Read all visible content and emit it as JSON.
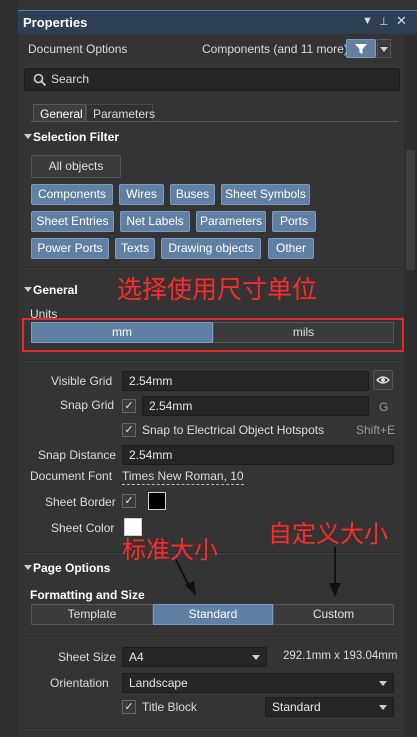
{
  "window": {
    "title": "Properties"
  },
  "header": {
    "left_label": "Document Options",
    "right_label": "Components (and 11 more)"
  },
  "search": {
    "placeholder": "Search"
  },
  "tabs": [
    {
      "label": "General"
    },
    {
      "label": "Parameters"
    }
  ],
  "selection_filter": {
    "title": "Selection Filter",
    "all_objects": "All objects",
    "chips": [
      "Components",
      "Wires",
      "Buses",
      "Sheet Symbols",
      "Sheet Entries",
      "Net Labels",
      "Parameters",
      "Ports",
      "Power Ports",
      "Texts",
      "Drawing objects",
      "Other"
    ]
  },
  "general": {
    "title": "General",
    "units_label": "Units",
    "units_options": [
      "mm",
      "mils"
    ],
    "units_selected": "mm",
    "visible_grid_label": "Visible Grid",
    "visible_grid_value": "2.54mm",
    "snap_grid_label": "Snap Grid",
    "snap_grid_value": "2.54mm",
    "snap_grid_shortcut": "G",
    "snap_hotspots_label": "Snap to Electrical Object Hotspots",
    "snap_hotspots_shortcut": "Shift+E",
    "snap_distance_label": "Snap Distance",
    "snap_distance_value": "2.54mm",
    "document_font_label": "Document Font",
    "document_font_value": "Times New Roman, 10",
    "sheet_border_label": "Sheet Border",
    "sheet_color_label": "Sheet Color",
    "sheet_border_color": "#000000",
    "sheet_color_color": "#ffffff"
  },
  "page_options": {
    "title": "Page Options",
    "formatting_label": "Formatting and Size",
    "format_tabs": [
      "Template",
      "Standard",
      "Custom"
    ],
    "format_selected": "Standard",
    "sheet_size_label": "Sheet Size",
    "sheet_size_value": "A4",
    "sheet_size_dims": "292.1mm x 193.04mm",
    "orientation_label": "Orientation",
    "orientation_value": "Landscape",
    "title_block_label": "Title Block",
    "title_block_value": "Standard"
  },
  "annotations": {
    "units": "选择使用尺寸单位",
    "standard": "标准大小",
    "custom": "自定义大小",
    "color": "#ff2a2a"
  },
  "colors": {
    "accent": "#5f7fa3",
    "titlebar": "#2e3f55"
  }
}
